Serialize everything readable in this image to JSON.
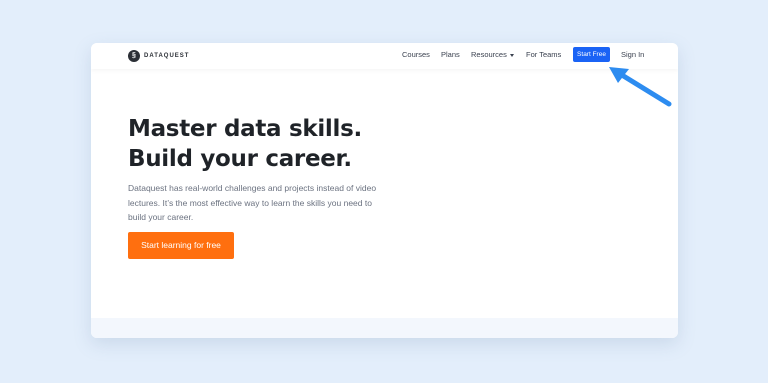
{
  "brand": {
    "name": "DATAQUEST",
    "mark": "§"
  },
  "nav": {
    "courses": "Courses",
    "plans": "Plans",
    "resources": "Resources",
    "teams": "For Teams",
    "start_free": "Start Free",
    "sign_in": "Sign In"
  },
  "hero": {
    "title_line1": "Master data skills.",
    "title_line2": "Build your career.",
    "description": "Dataquest has real-world challenges and projects instead of video lectures. It’s the most effective way to learn the skills you need to build your career.",
    "cta": "Start learning for free"
  },
  "colors": {
    "page_bg": "#e3eefb",
    "primary_blue": "#1a63f5",
    "cta_orange": "#ff6f0f",
    "arrow_blue": "#2d8cf0"
  },
  "icons": {
    "logo": "dataquest-logo-icon",
    "dropdown": "caret-down-icon",
    "annotation": "arrow-pointer-icon"
  }
}
